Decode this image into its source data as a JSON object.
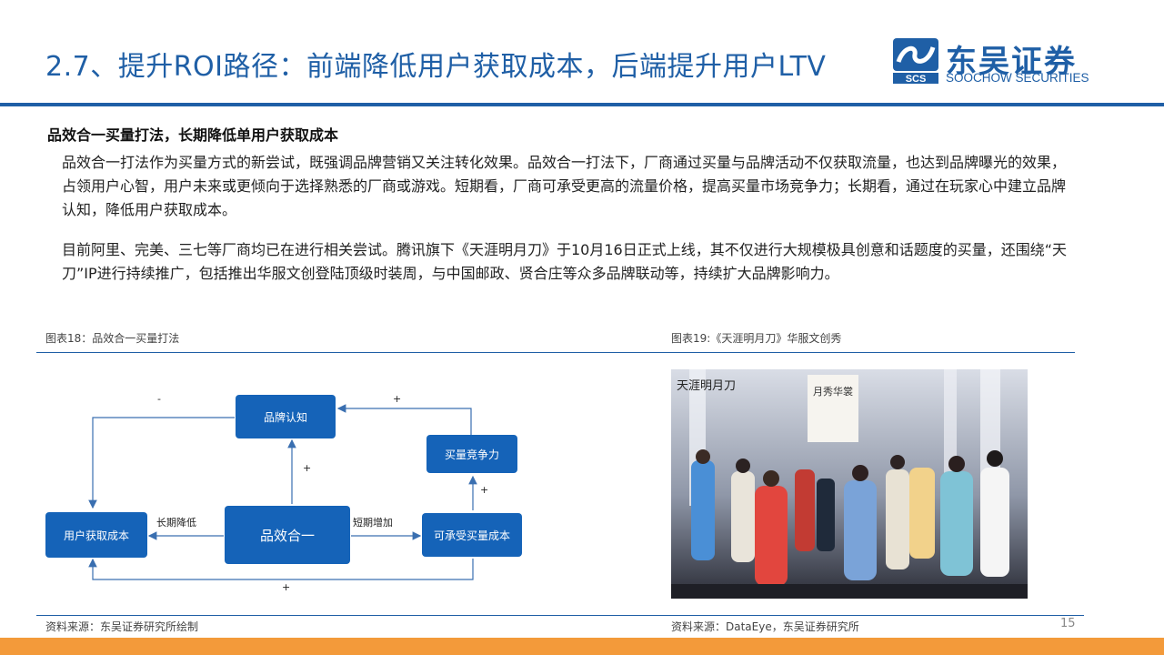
{
  "header": {
    "title": "2.7、提升ROI路径：前端降低用户获取成本，后端提升用户LTV",
    "logo_cn": "东吴证券",
    "logo_en": "SOOCHOW SECURITIES",
    "logo_mark": "SCS"
  },
  "content": {
    "subhead": "品效合一买量打法，长期降低单用户获取成本",
    "bullet_marker": "",
    "bullets": [
      "品效合一打法作为买量方式的新尝试，既强调品牌营销又关注转化效果。品效合一打法下，厂商通过买量与品牌活动不仅获取流量，也达到品牌曝光的效果，占领用户心智，用户未来或更倾向于选择熟悉的厂商或游戏。短期看，厂商可承受更高的流量价格，提高买量市场竞争力；长期看，通过在玩家心中建立品牌认知，降低用户获取成本。",
      "目前阿里、完美、三七等厂商均已在进行相关尝试。腾讯旗下《天涯明月刀》于10月16日正式上线，其不仅进行大规模极具创意和话题度的买量，还围绕“天刀”IP进行持续推广，包括推出华服文创登陆顶级时装周，与中国邮政、贤合庄等众多品牌联动等，持续扩大品牌影响力。"
    ]
  },
  "figure18": {
    "caption": "图表18：品效合一买量打法",
    "source": "资料来源：东吴证券研究所绘制",
    "boxes": {
      "brand": "品牌认知",
      "compete": "买量竞争力",
      "user_cost": "用户获取成本",
      "core": "品效合一",
      "afford": "可承受买量成本"
    },
    "labels": {
      "long_term": "长期降低",
      "short_term": "短期增加",
      "minus": "-",
      "plus_top": "+",
      "plus_mid": "+",
      "plus_right": "+",
      "plus_bottom": "+"
    }
  },
  "figure19": {
    "caption": "图表19:《天涯明月刀》华服文创秀",
    "source": "资料来源：DataEye，东吴证券研究所",
    "photo_text": "天涯明月刀",
    "banner_text": "月秀华裳"
  },
  "page_number": "15",
  "colors": {
    "primary": "#1f5fa6",
    "box": "#1563b8",
    "accent": "#f39a3a"
  }
}
